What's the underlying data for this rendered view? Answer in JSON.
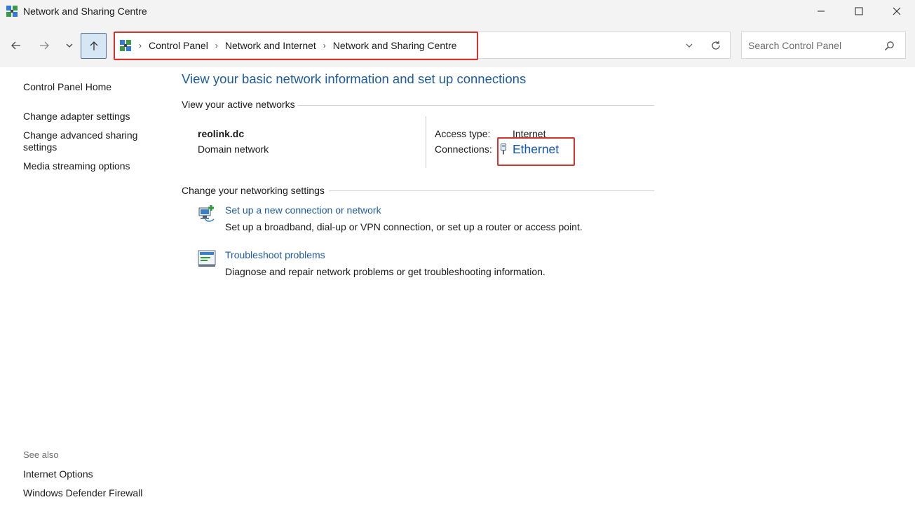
{
  "window": {
    "title": "Network and Sharing Centre"
  },
  "address": {
    "crumbs": [
      "Control Panel",
      "Network and Internet",
      "Network and Sharing Centre"
    ]
  },
  "search": {
    "placeholder": "Search Control Panel"
  },
  "sidebar": {
    "items": [
      {
        "label": "Control Panel Home"
      },
      {
        "label": "Change adapter settings"
      },
      {
        "label": "Change advanced sharing"
      },
      {
        "label": "settings"
      },
      {
        "label": "Media streaming options"
      }
    ],
    "see_also_label": "See also",
    "see_also": [
      {
        "label": "Internet Options"
      },
      {
        "label": "Windows Defender Firewall"
      }
    ]
  },
  "main": {
    "title": "View your basic network information and set up connections",
    "active_networks_header": "View your active networks",
    "network": {
      "name": "reolink.dc",
      "type": "Domain network",
      "access_type_label": "Access type:",
      "access_type_value": "Internet",
      "connections_label": "Connections:",
      "connections_value": "Ethernet"
    },
    "settings_header": "Change your networking settings",
    "tasks": [
      {
        "link": "Set up a new connection or network",
        "desc": "Set up a broadband, dial-up or VPN connection, or set up a router or access point.",
        "icon": "new-connection-icon"
      },
      {
        "link": "Troubleshoot problems",
        "desc": "Diagnose and repair network problems or get troubleshooting information.",
        "icon": "troubleshoot-icon"
      }
    ]
  },
  "colors": {
    "link": "#1e5b9e",
    "highlight": "#d6322e",
    "up_button_bg": "#d6e6f5"
  }
}
